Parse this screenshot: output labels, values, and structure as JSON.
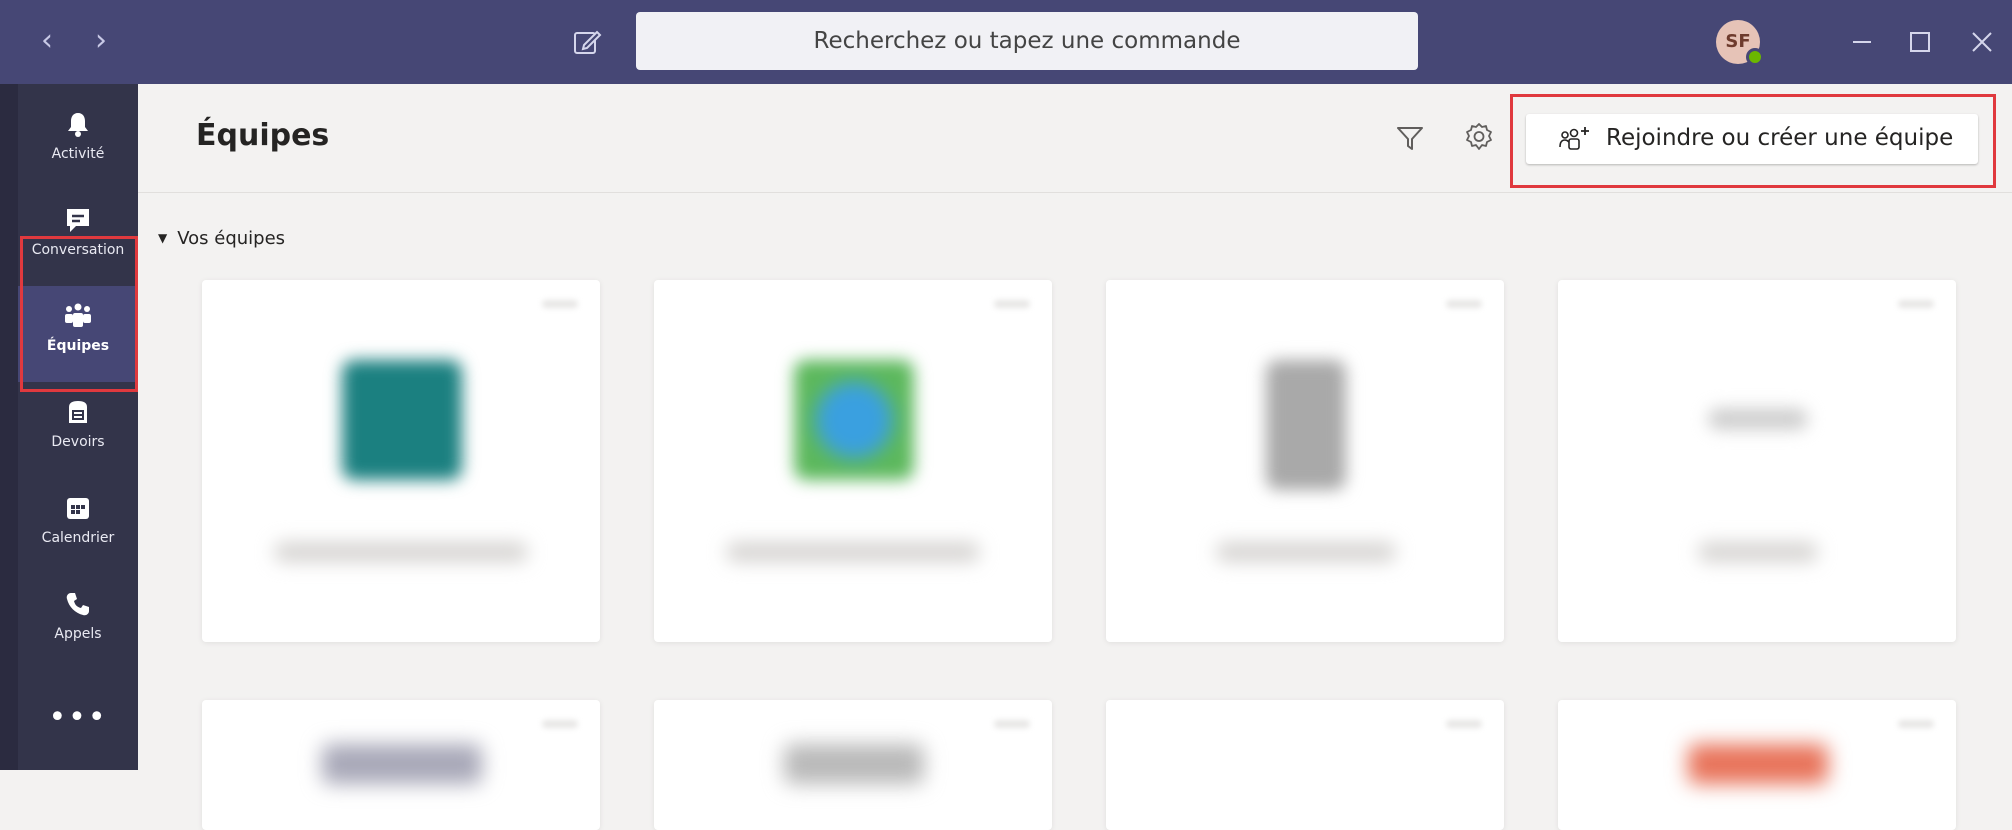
{
  "titlebar": {
    "search_placeholder": "Recherchez ou tapez une commande",
    "avatar_initials": "SF",
    "accent": "#464775"
  },
  "rail": {
    "items": [
      {
        "label": "Activité",
        "icon": "bell-icon"
      },
      {
        "label": "Conversation",
        "icon": "chat-icon"
      },
      {
        "label": "Équipes",
        "icon": "teams-icon",
        "active": true
      },
      {
        "label": "Devoirs",
        "icon": "assignments-icon"
      },
      {
        "label": "Calendrier",
        "icon": "calendar-icon"
      },
      {
        "label": "Appels",
        "icon": "phone-icon"
      }
    ],
    "more_label": "•••"
  },
  "header": {
    "title": "Équipes",
    "join_label": "Rejoindre ou créer une équipe"
  },
  "section": {
    "label": "Vos équipes"
  },
  "colors": {
    "highlight": "#e0393e",
    "rail_bg": "#33344a",
    "presence": "#6bb700"
  }
}
